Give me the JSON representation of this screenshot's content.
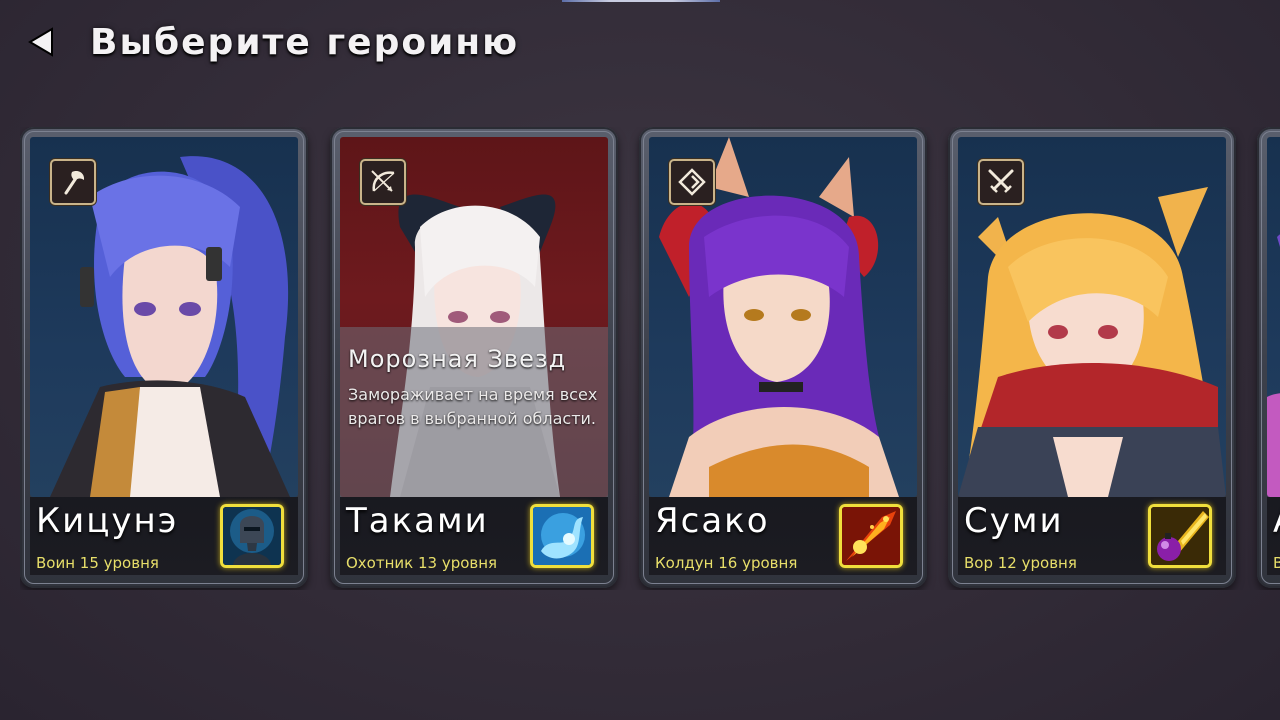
{
  "header": {
    "back_icon": "back-arrow-icon",
    "title": "Выберите героиню"
  },
  "heroes": [
    {
      "name": "Кицунэ",
      "level_text": "Воин 15 уровня",
      "class_icon": "axe-icon",
      "skill_icon": "knight-helmet-icon",
      "art_background": "#1e3a5c"
    },
    {
      "name": "Таками",
      "level_text": "Охотник 13 уровня",
      "class_icon": "bow-icon",
      "skill_icon": "ice-orb-icon",
      "art_background": "#6e1a1e",
      "skill": {
        "name": "Морозная Звезд",
        "description": "Замораживает на время всех врагов в выбранной области."
      }
    },
    {
      "name": "Ясако",
      "level_text": "Колдун 16 уровня",
      "class_icon": "rune-icon",
      "skill_icon": "fire-blast-icon",
      "art_background": "#1e3a5c"
    },
    {
      "name": "Суми",
      "level_text": "Вор 12 уровня",
      "class_icon": "crossed-swords-icon",
      "skill_icon": "bomb-icon",
      "art_background": "#1e3a5c"
    },
    {
      "name": "А",
      "level_text": "В"
    }
  ],
  "colors": {
    "level_text": "#e8df6a",
    "skill_icon_border": "#f0df3c",
    "class_icon_border": "#c9b48a"
  }
}
